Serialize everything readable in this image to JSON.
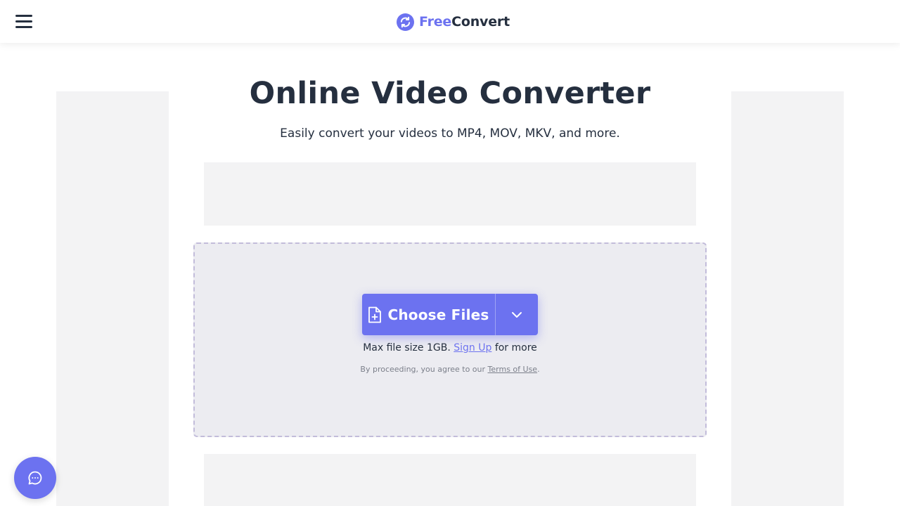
{
  "header": {
    "menu_icon": "hamburger-menu-icon",
    "logo": {
      "icon": "refresh-circle-icon",
      "brand_part1": "Free",
      "brand_part2": "Convert",
      "color_accent": "#6c72f0"
    }
  },
  "main": {
    "title": "Online Video Converter",
    "subtitle": "Easily convert your videos to MP4, MOV, MKV, and more."
  },
  "upload": {
    "choose_files_label": "Choose Files",
    "choose_files_icon": "file-plus-icon",
    "dropdown_icon": "chevron-down-icon",
    "max_size_prefix": "Max file size 1GB.",
    "sign_up_link": "Sign Up",
    "max_size_suffix": "for more",
    "terms_prefix": "By proceeding, you agree to our",
    "terms_link": "Terms of Use",
    "terms_suffix": "."
  },
  "chat": {
    "icon": "chat-bubble-icon"
  },
  "colors": {
    "accent": "#6c72f0",
    "text": "#252f3f",
    "ad_placeholder": "#f3f3f4",
    "dropzone_bg": "#ececf1"
  }
}
